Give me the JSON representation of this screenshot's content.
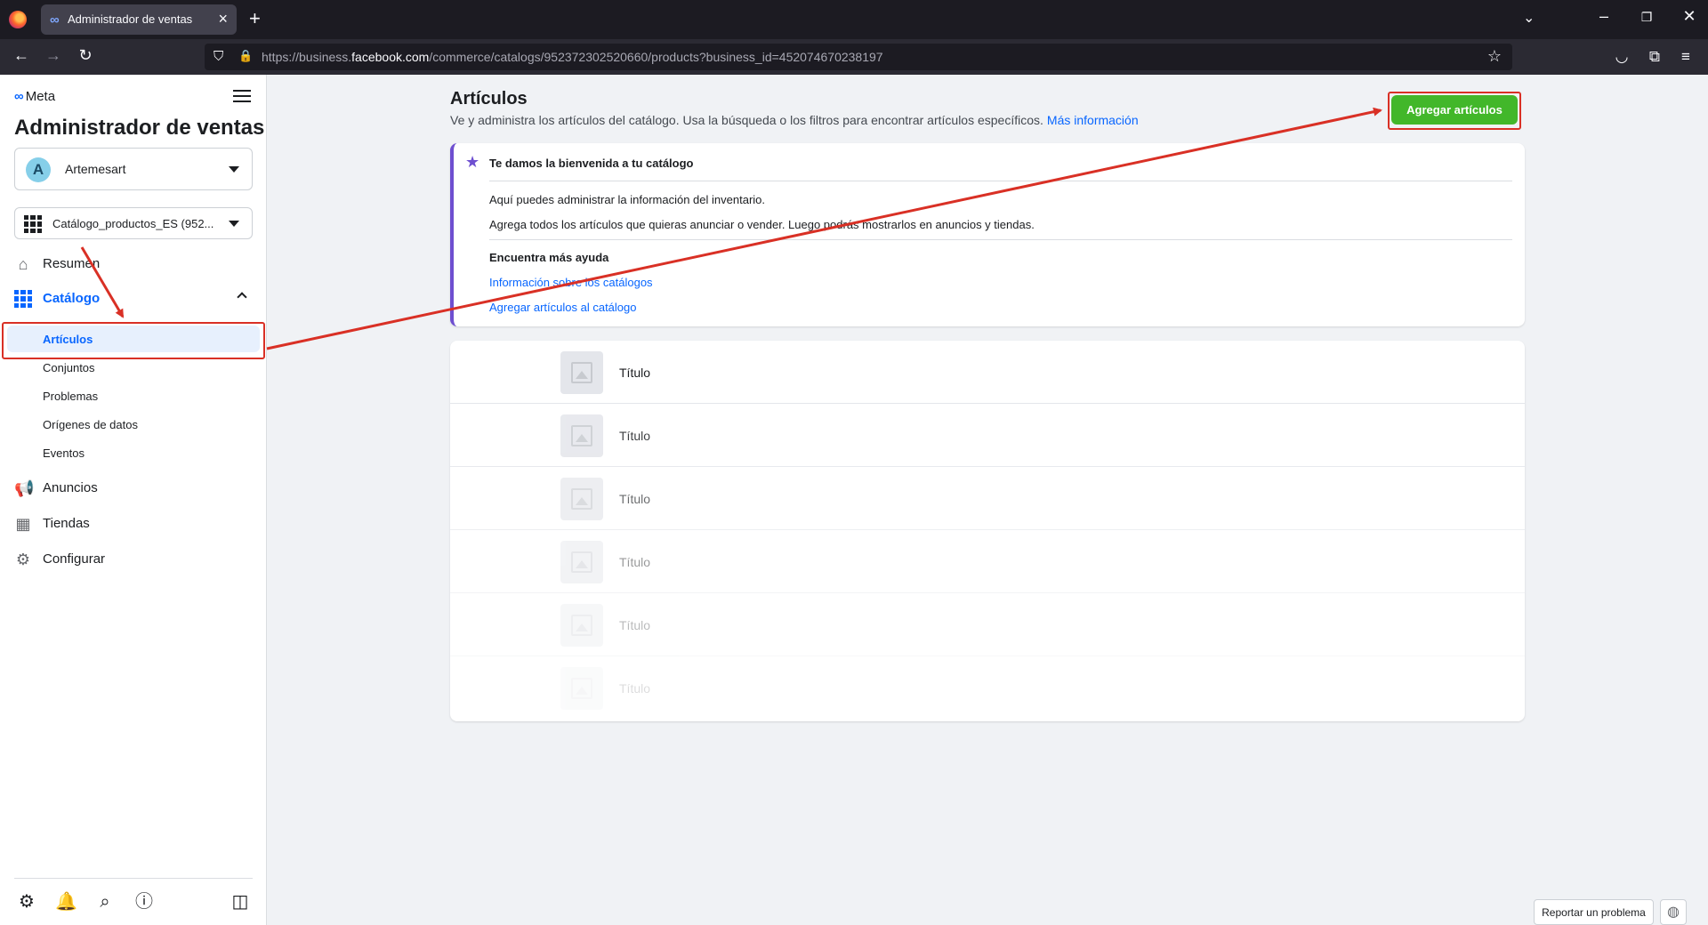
{
  "browser": {
    "tab_title": "Administrador de ventas",
    "url_prefix": "https://business.",
    "url_host": "facebook.com",
    "url_path": "/commerce/catalogs/952372302520660/products?business_id=452074670238197"
  },
  "sidebar": {
    "brand": "Meta",
    "app_title": "Administrador de ventas",
    "account": {
      "initial": "A",
      "name": "Artemesart"
    },
    "catalog_selector": "Catálogo_productos_ES (952...",
    "nav": {
      "resumen": "Resumen",
      "catalogo": "Catálogo",
      "anuncios": "Anuncios",
      "tiendas": "Tiendas",
      "configurar": "Configurar"
    },
    "catalog_sub": {
      "articulos": "Artículos",
      "conjuntos": "Conjuntos",
      "problemas": "Problemas",
      "origenes": "Orígenes de datos",
      "eventos": "Eventos"
    }
  },
  "main": {
    "title": "Artículos",
    "description": "Ve y administra los artículos del catálogo. Usa la búsqueda o los filtros para encontrar artículos específicos.",
    "learn_more": "Más información",
    "add_button": "Agregar artículos",
    "welcome": {
      "title": "Te damos la bienvenida a tu catálogo",
      "line1": "Aquí puedes administrar la información del inventario.",
      "line2": "Agrega todos los artículos que quieras anunciar o vender. Luego podrás mostrarlos en anuncios y tiendas.",
      "help_title": "Encuentra más ayuda",
      "link1": "Información sobre los catálogos",
      "link2": "Agregar artículos al catálogo"
    },
    "placeholder_rows": [
      "Título",
      "Título",
      "Título",
      "Título",
      "Título",
      "Título"
    ]
  },
  "footer": {
    "report": "Reportar un problema"
  },
  "colors": {
    "accent": "#0866ff",
    "add_button": "#42b72a",
    "annotation": "#d93025",
    "welcome_border": "#6e4fd0"
  }
}
